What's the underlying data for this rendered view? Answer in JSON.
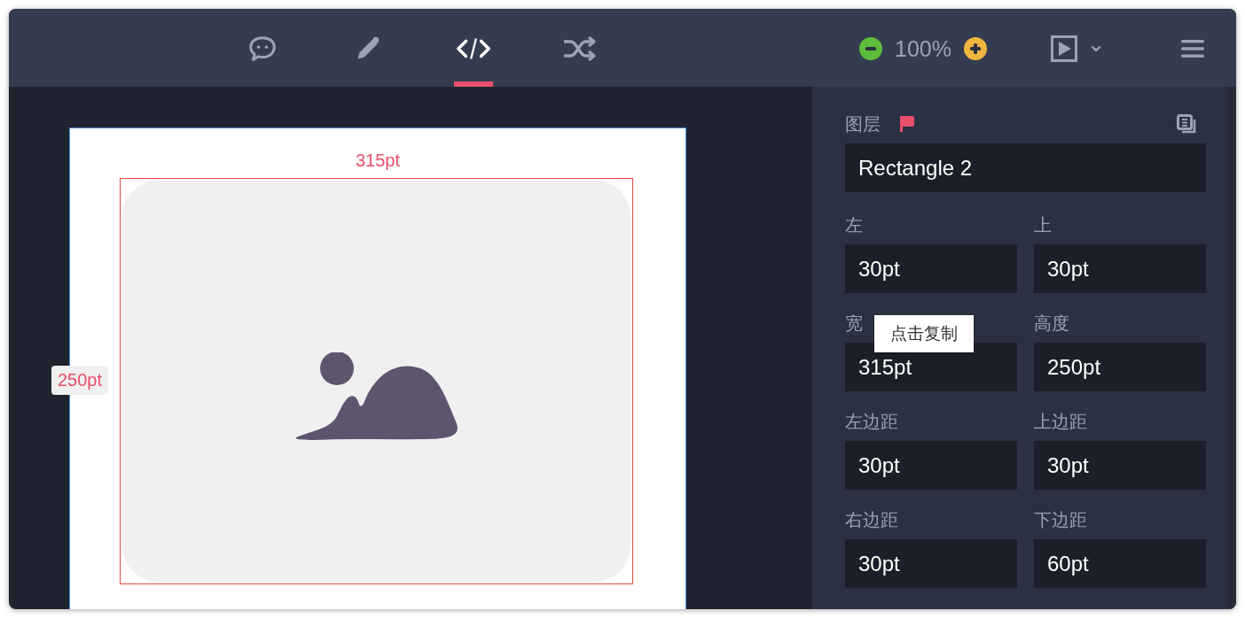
{
  "toolbar": {
    "tabs": [
      {
        "kind": "comment",
        "selected": false
      },
      {
        "kind": "edit",
        "selected": false
      },
      {
        "kind": "code",
        "selected": true
      },
      {
        "kind": "shuffle",
        "selected": false
      }
    ],
    "zoom": "100%"
  },
  "canvas": {
    "width_label": "315pt",
    "height_label": "250pt"
  },
  "panel": {
    "layer_label": "图层",
    "layer_name": "Rectangle 2",
    "fields": [
      {
        "label": "左",
        "value": "30pt"
      },
      {
        "label": "上",
        "value": "30pt"
      },
      {
        "label": "宽",
        "value": "315pt"
      },
      {
        "label": "高度",
        "value": "250pt"
      },
      {
        "label": "左边距",
        "value": "30pt"
      },
      {
        "label": "上边距",
        "value": "30pt"
      },
      {
        "label": "右边距",
        "value": "30pt"
      },
      {
        "label": "下边距",
        "value": "60pt"
      }
    ],
    "tooltip": "点击复制"
  }
}
